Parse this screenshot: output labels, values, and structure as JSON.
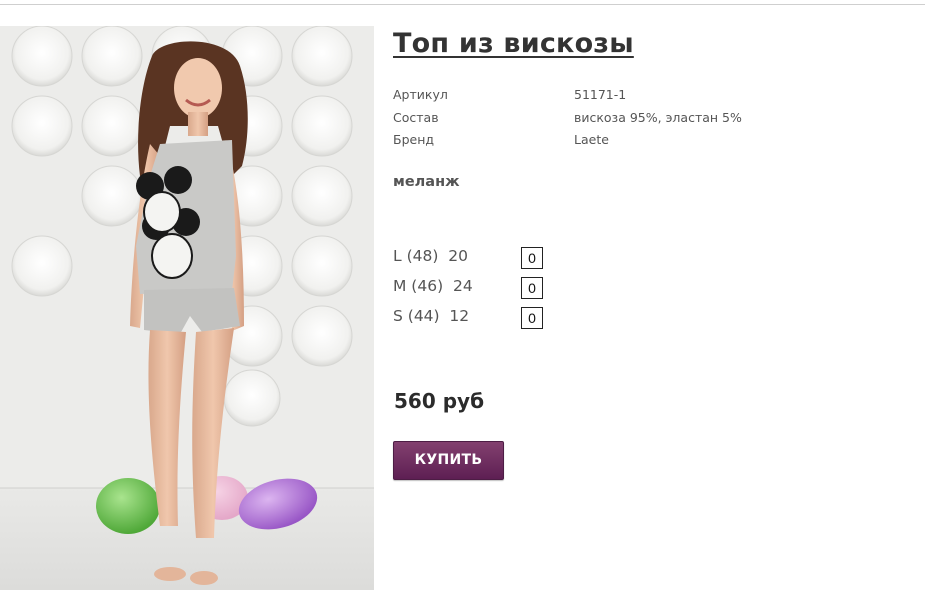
{
  "product": {
    "title": "Топ из вискозы",
    "attributes": [
      {
        "label": "Артикул",
        "value": "51171-1"
      },
      {
        "label": "Состав",
        "value": "вискоза 95%, эластан 5%"
      },
      {
        "label": "Бренд",
        "value": "Laete"
      }
    ],
    "color": "меланж",
    "sizes": [
      {
        "label": "L (48)  20",
        "qty": "0"
      },
      {
        "label": "M (46)  24",
        "qty": "0"
      },
      {
        "label": "S (44)  12",
        "qty": "0"
      }
    ],
    "price": "560 руб",
    "buy_label": "КУПИТЬ",
    "accent_color": "#6a2a5e"
  }
}
